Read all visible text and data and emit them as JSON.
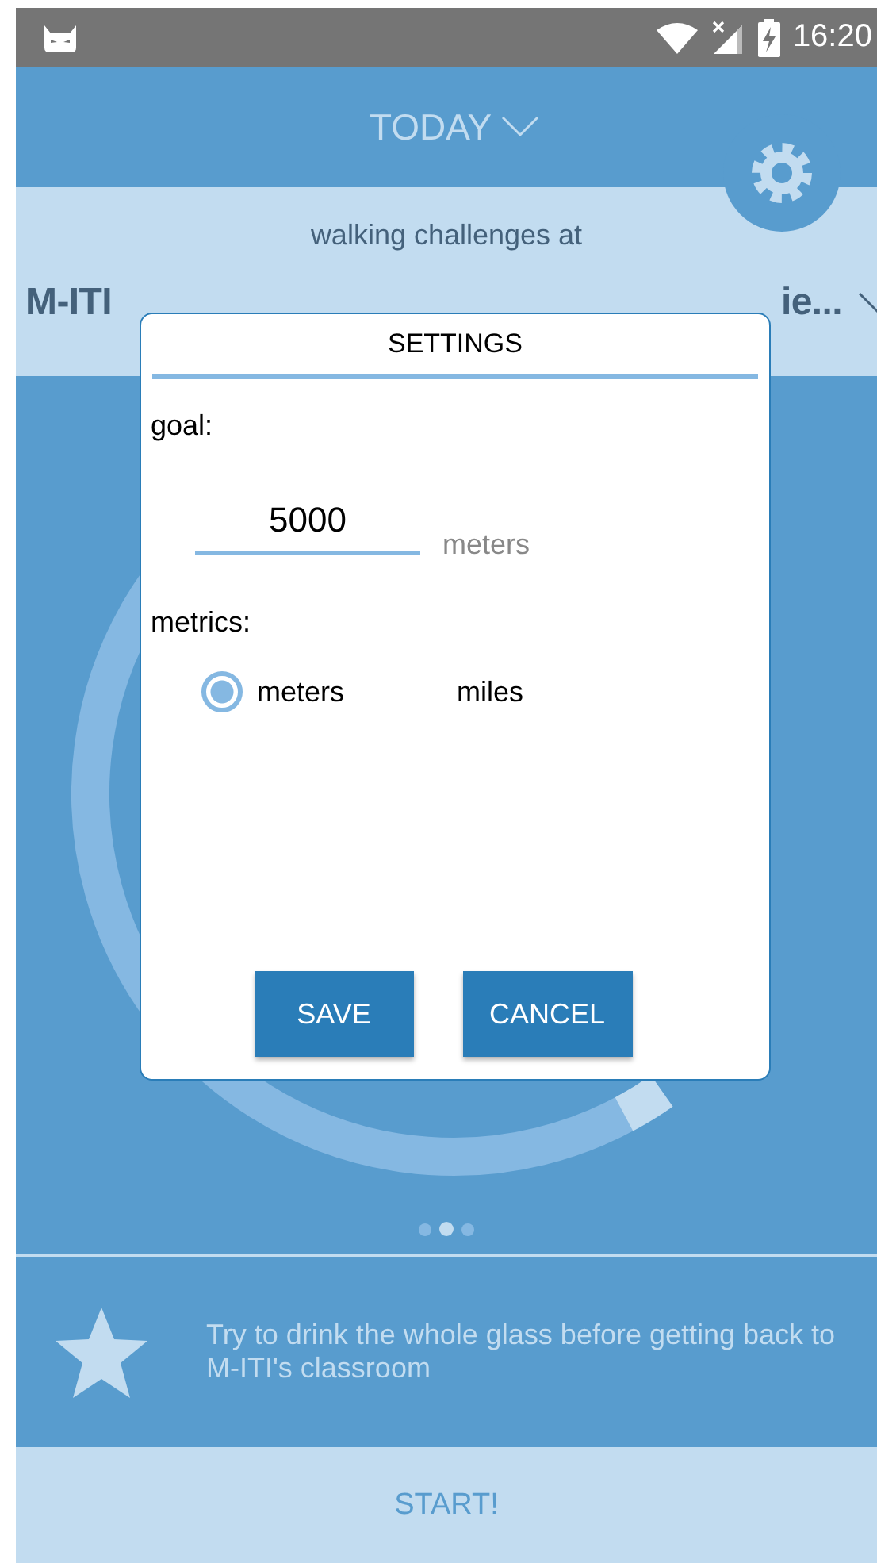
{
  "status_bar": {
    "time": "16:20"
  },
  "header": {
    "title": "TODAY"
  },
  "location": {
    "caption": "walking challenges at",
    "name_start": "M-ITI",
    "name_end": "ie..."
  },
  "pager": {
    "pages": [
      {
        "selected": false
      },
      {
        "selected": true
      },
      {
        "selected": false
      }
    ]
  },
  "tip": {
    "text": "Try to drink the whole glass before getting back to M-ITI's classroom"
  },
  "start_button": "START!",
  "dialog": {
    "title": "SETTINGS",
    "goal_label": "goal:",
    "goal": {
      "value": "5000",
      "unit": "meters"
    },
    "metrics_label": "metrics:",
    "metrics": [
      {
        "label": "meters",
        "selected": true
      },
      {
        "label": "miles",
        "selected": false
      }
    ],
    "buttons": [
      "SAVE",
      "CANCEL"
    ]
  }
}
